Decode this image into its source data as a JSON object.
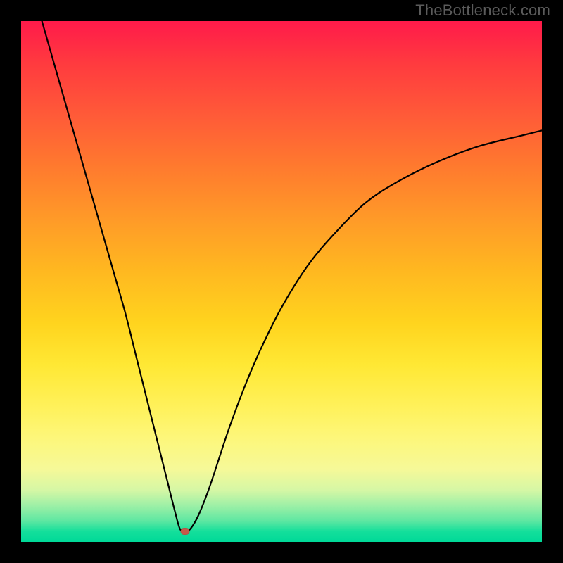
{
  "watermark": "TheBottleneck.com",
  "chart_data": {
    "type": "line",
    "title": "",
    "xlabel": "",
    "ylabel": "",
    "xlim": [
      0,
      100
    ],
    "ylim": [
      0,
      100
    ],
    "grid": false,
    "legend": false,
    "series": [
      {
        "name": "bottleneck-curve",
        "x": [
          4.0,
          6,
          8,
          10,
          12,
          14,
          16,
          18,
          20,
          22,
          24,
          26,
          28,
          29.5,
          30.5,
          31.5,
          32.5,
          34,
          36,
          38,
          40,
          43,
          46,
          50,
          55,
          60,
          66,
          72,
          80,
          88,
          96,
          100
        ],
        "y": [
          100,
          93,
          86,
          79,
          72,
          65,
          58,
          51,
          44,
          36,
          28,
          20,
          12,
          6,
          2.5,
          2.0,
          2.5,
          5,
          10,
          16,
          22,
          30,
          37,
          45,
          53,
          59,
          65,
          69,
          73,
          76,
          78,
          79
        ]
      }
    ],
    "marker": {
      "x": 31.5,
      "y": 2.0,
      "name": "optimal-point"
    }
  },
  "colors": {
    "gradient_top": "#ff1a4a",
    "gradient_mid": "#ffe834",
    "gradient_bottom": "#00d998",
    "curve": "#000000",
    "marker": "#c65a4a",
    "frame": "#000000"
  }
}
